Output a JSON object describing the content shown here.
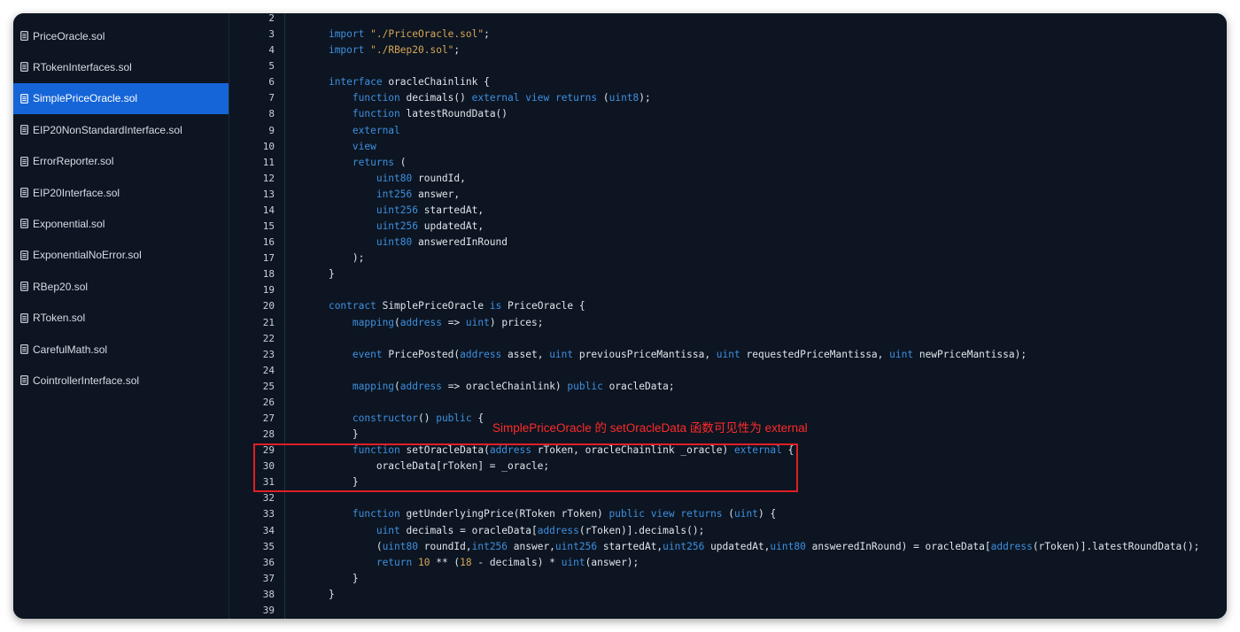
{
  "sidebar": {
    "files": [
      {
        "name": "PriceOracle.sol",
        "active": false
      },
      {
        "name": "RTokenInterfaces.sol",
        "active": false
      },
      {
        "name": "SimplePriceOracle.sol",
        "active": true
      },
      {
        "name": "EIP20NonStandardInterface.sol",
        "active": false
      },
      {
        "name": "ErrorReporter.sol",
        "active": false
      },
      {
        "name": "EIP20Interface.sol",
        "active": false
      },
      {
        "name": "Exponential.sol",
        "active": false
      },
      {
        "name": "ExponentialNoError.sol",
        "active": false
      },
      {
        "name": "RBep20.sol",
        "active": false
      },
      {
        "name": "RToken.sol",
        "active": false
      },
      {
        "name": "CarefulMath.sol",
        "active": false
      },
      {
        "name": "CointrollerInterface.sol",
        "active": false
      }
    ],
    "icon": "file-icon"
  },
  "editor": {
    "lines": [
      {
        "n": "2",
        "tokens": []
      },
      {
        "n": "3",
        "tokens": [
          [
            "",
            "    "
          ],
          [
            "kw",
            "import"
          ],
          [
            "",
            " "
          ],
          [
            "str",
            "\"./PriceOracle.sol\""
          ],
          [
            "",
            ";"
          ]
        ]
      },
      {
        "n": "4",
        "tokens": [
          [
            "",
            "    "
          ],
          [
            "kw",
            "import"
          ],
          [
            "",
            " "
          ],
          [
            "str",
            "\"./RBep20.sol\""
          ],
          [
            "",
            ";"
          ]
        ]
      },
      {
        "n": "5",
        "tokens": []
      },
      {
        "n": "6",
        "tokens": [
          [
            "",
            "    "
          ],
          [
            "kw",
            "interface"
          ],
          [
            "",
            " oracleChainlink {"
          ]
        ]
      },
      {
        "n": "7",
        "tokens": [
          [
            "",
            "        "
          ],
          [
            "kw",
            "function"
          ],
          [
            "",
            " decimals() "
          ],
          [
            "kw",
            "external"
          ],
          [
            "",
            " "
          ],
          [
            "kw",
            "view"
          ],
          [
            "",
            " "
          ],
          [
            "kw",
            "returns"
          ],
          [
            "",
            " ("
          ],
          [
            "kw",
            "uint8"
          ],
          [
            "",
            ");"
          ]
        ]
      },
      {
        "n": "8",
        "tokens": [
          [
            "",
            "        "
          ],
          [
            "kw",
            "function"
          ],
          [
            "",
            " latestRoundData()"
          ]
        ]
      },
      {
        "n": "9",
        "tokens": [
          [
            "",
            "        "
          ],
          [
            "kw",
            "external"
          ]
        ]
      },
      {
        "n": "10",
        "tokens": [
          [
            "",
            "        "
          ],
          [
            "kw",
            "view"
          ]
        ]
      },
      {
        "n": "11",
        "tokens": [
          [
            "",
            "        "
          ],
          [
            "kw",
            "returns"
          ],
          [
            "",
            " ("
          ]
        ]
      },
      {
        "n": "12",
        "tokens": [
          [
            "",
            "            "
          ],
          [
            "kw",
            "uint80"
          ],
          [
            "",
            " roundId,"
          ]
        ]
      },
      {
        "n": "13",
        "tokens": [
          [
            "",
            "            "
          ],
          [
            "kw",
            "int256"
          ],
          [
            "",
            " answer,"
          ]
        ]
      },
      {
        "n": "14",
        "tokens": [
          [
            "",
            "            "
          ],
          [
            "kw",
            "uint256"
          ],
          [
            "",
            " startedAt,"
          ]
        ]
      },
      {
        "n": "15",
        "tokens": [
          [
            "",
            "            "
          ],
          [
            "kw",
            "uint256"
          ],
          [
            "",
            " updatedAt,"
          ]
        ]
      },
      {
        "n": "16",
        "tokens": [
          [
            "",
            "            "
          ],
          [
            "kw",
            "uint80"
          ],
          [
            "",
            " answeredInRound"
          ]
        ]
      },
      {
        "n": "17",
        "tokens": [
          [
            "",
            "        );"
          ]
        ]
      },
      {
        "n": "18",
        "tokens": [
          [
            "",
            "    }"
          ]
        ]
      },
      {
        "n": "19",
        "tokens": []
      },
      {
        "n": "20",
        "tokens": [
          [
            "",
            "    "
          ],
          [
            "kw",
            "contract"
          ],
          [
            "",
            " SimplePriceOracle "
          ],
          [
            "kw",
            "is"
          ],
          [
            "",
            " PriceOracle {"
          ]
        ]
      },
      {
        "n": "21",
        "tokens": [
          [
            "",
            "        "
          ],
          [
            "kw",
            "mapping"
          ],
          [
            "",
            "("
          ],
          [
            "kw",
            "address"
          ],
          [
            "",
            " => "
          ],
          [
            "kw",
            "uint"
          ],
          [
            "",
            ") prices;"
          ]
        ]
      },
      {
        "n": "22",
        "tokens": []
      },
      {
        "n": "23",
        "tokens": [
          [
            "",
            "        "
          ],
          [
            "kw",
            "event"
          ],
          [
            "",
            " PricePosted("
          ],
          [
            "kw",
            "address"
          ],
          [
            "",
            " asset, "
          ],
          [
            "kw",
            "uint"
          ],
          [
            "",
            " previousPriceMantissa, "
          ],
          [
            "kw",
            "uint"
          ],
          [
            "",
            " requestedPriceMantissa, "
          ],
          [
            "kw",
            "uint"
          ],
          [
            "",
            " newPriceMantissa);"
          ]
        ]
      },
      {
        "n": "24",
        "tokens": []
      },
      {
        "n": "25",
        "tokens": [
          [
            "",
            "        "
          ],
          [
            "kw",
            "mapping"
          ],
          [
            "",
            "("
          ],
          [
            "kw",
            "address"
          ],
          [
            "",
            " => oracleChainlink) "
          ],
          [
            "kw",
            "public"
          ],
          [
            "",
            " oracleData;"
          ]
        ]
      },
      {
        "n": "26",
        "tokens": []
      },
      {
        "n": "27",
        "tokens": [
          [
            "",
            "        "
          ],
          [
            "kw",
            "constructor"
          ],
          [
            "",
            "() "
          ],
          [
            "kw",
            "public"
          ],
          [
            "",
            " {"
          ]
        ]
      },
      {
        "n": "28",
        "tokens": [
          [
            "",
            "        }"
          ]
        ]
      },
      {
        "n": "29",
        "tokens": [
          [
            "",
            "        "
          ],
          [
            "kw",
            "function"
          ],
          [
            "",
            " setOracleData("
          ],
          [
            "kw",
            "address"
          ],
          [
            "",
            " rToken, oracleChainlink _oracle) "
          ],
          [
            "kw",
            "external"
          ],
          [
            "",
            " {"
          ]
        ]
      },
      {
        "n": "30",
        "tokens": [
          [
            "",
            "            oracleData[rToken] = _oracle;"
          ]
        ]
      },
      {
        "n": "31",
        "tokens": [
          [
            "",
            "        }"
          ]
        ]
      },
      {
        "n": "32",
        "tokens": []
      },
      {
        "n": "33",
        "tokens": [
          [
            "",
            "        "
          ],
          [
            "kw",
            "function"
          ],
          [
            "",
            " getUnderlyingPrice(RToken rToken) "
          ],
          [
            "kw",
            "public"
          ],
          [
            "",
            " "
          ],
          [
            "kw",
            "view"
          ],
          [
            "",
            " "
          ],
          [
            "kw",
            "returns"
          ],
          [
            "",
            " ("
          ],
          [
            "kw",
            "uint"
          ],
          [
            "",
            ") {"
          ]
        ]
      },
      {
        "n": "34",
        "tokens": [
          [
            "",
            "            "
          ],
          [
            "kw",
            "uint"
          ],
          [
            "",
            " decimals = oracleData["
          ],
          [
            "kw",
            "address"
          ],
          [
            "",
            "(rToken)].decimals();"
          ]
        ]
      },
      {
        "n": "35",
        "tokens": [
          [
            "",
            "            ("
          ],
          [
            "kw",
            "uint80"
          ],
          [
            "",
            " roundId,"
          ],
          [
            "kw",
            "int256"
          ],
          [
            "",
            " answer,"
          ],
          [
            "kw",
            "uint256"
          ],
          [
            "",
            " startedAt,"
          ],
          [
            "kw",
            "uint256"
          ],
          [
            "",
            " updatedAt,"
          ],
          [
            "kw",
            "uint80"
          ],
          [
            "",
            " answeredInRound) = oracleData["
          ],
          [
            "kw",
            "address"
          ],
          [
            "",
            "(rToken)].latestRoundData();"
          ]
        ]
      },
      {
        "n": "36",
        "tokens": [
          [
            "",
            "            "
          ],
          [
            "kw",
            "return"
          ],
          [
            "",
            " "
          ],
          [
            "num",
            "10"
          ],
          [
            "",
            " ** ("
          ],
          [
            "num",
            "18"
          ],
          [
            "",
            " - decimals) * "
          ],
          [
            "kw",
            "uint"
          ],
          [
            "",
            "(answer);"
          ]
        ]
      },
      {
        "n": "37",
        "tokens": [
          [
            "",
            "        }"
          ]
        ]
      },
      {
        "n": "38",
        "tokens": [
          [
            "",
            "    }"
          ]
        ]
      },
      {
        "n": "39",
        "tokens": []
      }
    ]
  },
  "annotation": {
    "text": "SimplePriceOracle 的 setOracleData 函数可见性为 external",
    "color": "#e01f26"
  },
  "colors": {
    "background": "#0c1521",
    "active_item": "#1565d8",
    "keyword": "#3f8fe0",
    "string": "#d8a657"
  }
}
